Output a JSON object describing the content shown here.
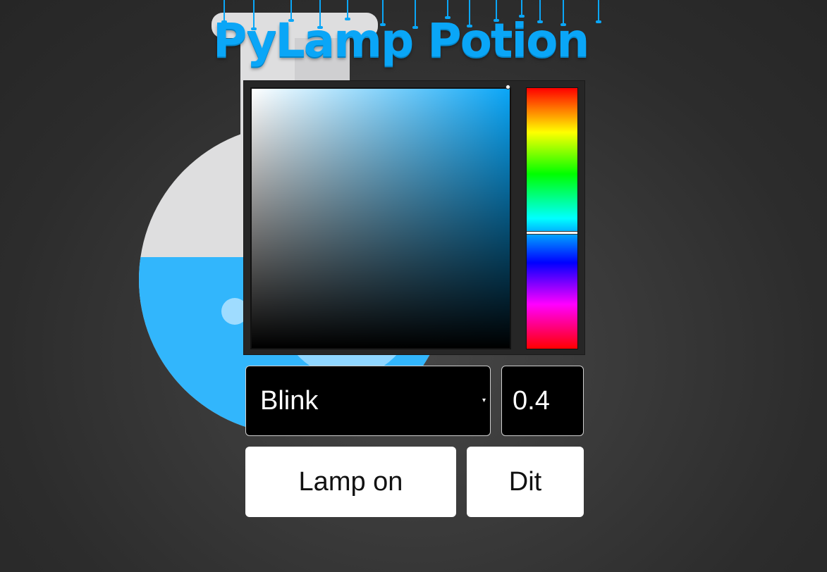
{
  "app": {
    "title": "PyLamp Potion"
  },
  "controls": {
    "effect_select": {
      "selected": "Blink",
      "options": [
        "Blink"
      ]
    },
    "speed_input": {
      "value": "0.4"
    },
    "lamp_button_label": "Lamp on",
    "dit_button_label": "Dit"
  },
  "color_picker": {
    "selected_color": "#0aa6f7",
    "hue_level": 0.555,
    "saturation": 1.0,
    "value": 1.0
  },
  "colors": {
    "title": "#0aa6f7",
    "flask_glass": "#dededf",
    "flask_liquid": "#32b6fc",
    "background": "#333333"
  },
  "icons": {
    "select_arrow": "chevron-down-icon"
  }
}
